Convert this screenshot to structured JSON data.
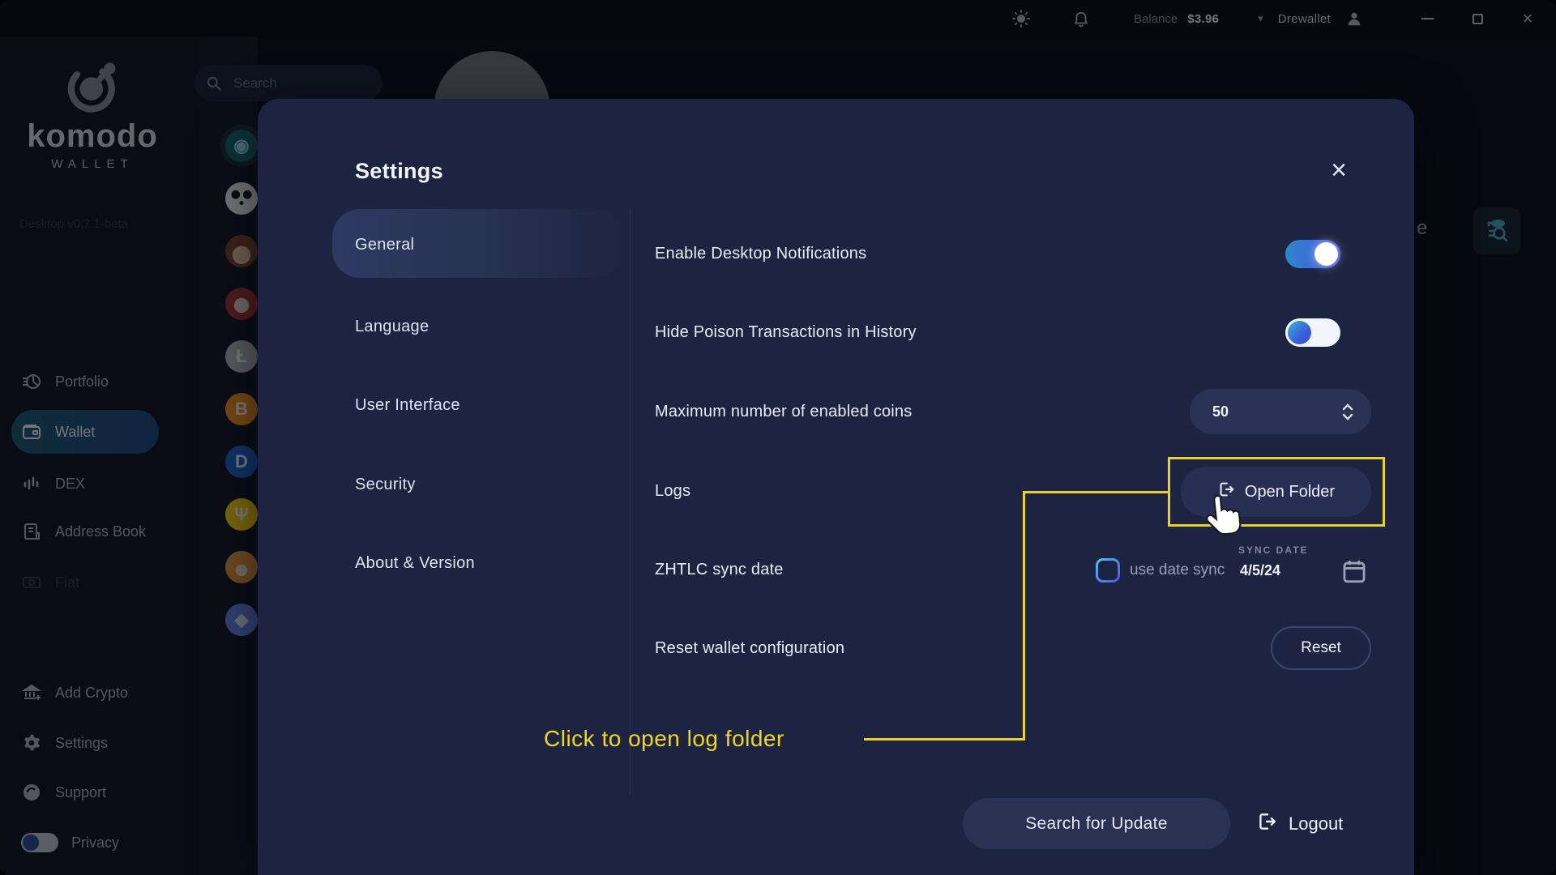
{
  "topbar": {
    "balance_label": "Balance",
    "balance_value": "$3.96",
    "account_name": "Drewallet"
  },
  "search": {
    "placeholder": "Search"
  },
  "sidebar": {
    "logo_title": "komodo",
    "logo_subtitle": "WALLET",
    "version": "Desktop v0.7.1-beta",
    "nav": [
      {
        "label": "Portfolio"
      },
      {
        "label": "Wallet"
      },
      {
        "label": "DEX"
      },
      {
        "label": "Address Book"
      },
      {
        "label": "Fiat"
      }
    ],
    "bottom_nav": [
      {
        "label": "Add Crypto"
      },
      {
        "label": "Settings"
      },
      {
        "label": "Support"
      }
    ],
    "privacy_label": "Privacy"
  },
  "coins": [
    {
      "icon": "komodo-coin-icon",
      "bg": "#156570",
      "letter": "◉",
      "fg": "#9fe0e6"
    },
    {
      "icon": "panda-coin-icon",
      "bg": "radial-gradient(circle at 32% 38%, #15161a 14%, rgba(0,0,0,0) 15%), radial-gradient(circle at 68% 38%, #15161a 14%, rgba(0,0,0,0) 15%), radial-gradient(circle at 50% 64%, #15161a 7%, rgba(0,0,0,0) 8%), #eef0f2",
      "letter": "",
      "fg": ""
    },
    {
      "icon": "anime-girl-coin-icon",
      "bg": "radial-gradient(circle at 50% 62%, #e8c49a 34%, #7a4630 36%)",
      "letter": "",
      "fg": ""
    },
    {
      "icon": "grandma-coin-icon",
      "bg": "radial-gradient(circle at 50% 55%, #e9d9cf 30%, #a43636 32%)",
      "letter": "",
      "fg": ""
    },
    {
      "icon": "litecoin-icon",
      "bg": "#b8babd",
      "letter": "Ł",
      "fg": "#ffffff"
    },
    {
      "icon": "bitcoin-icon",
      "bg": "#f7931a",
      "letter": "B",
      "fg": "#ffffff"
    },
    {
      "icon": "digibyte-icon",
      "bg": "#1f67d2",
      "letter": "D",
      "fg": "#ffffff"
    },
    {
      "icon": "primecoin-icon",
      "bg": "#ffd60a",
      "letter": "Ψ",
      "fg": "#ffffff"
    },
    {
      "icon": "shiba-coin-icon",
      "bg": "radial-gradient(circle at 50% 60%, #f4e6c8 22%, #e8973a 24%)",
      "letter": "",
      "fg": ""
    },
    {
      "icon": "ethereum-icon",
      "bg": "#6b86e8",
      "letter": "◆",
      "fg": "#dfe6ff"
    }
  ],
  "background": {
    "partial_text": "e"
  },
  "modal": {
    "title": "Settings",
    "tabs": [
      {
        "label": "General",
        "active": true
      },
      {
        "label": "Language",
        "active": false
      },
      {
        "label": "User Interface",
        "active": false
      },
      {
        "label": "Security",
        "active": false
      },
      {
        "label": "About & Version",
        "active": false
      }
    ],
    "rows": {
      "notifications": {
        "label": "Enable Desktop Notifications",
        "state": "on"
      },
      "hide_poison": {
        "label": "Hide Poison Transactions in History",
        "state": "on"
      },
      "max_coins": {
        "label": "Maximum number of enabled coins",
        "value": "50"
      },
      "logs": {
        "label": "Logs",
        "button_label": "Open Folder"
      },
      "zhtlc": {
        "label": "ZHTLC sync date",
        "checkbox_label": "use date sync",
        "checkbox_checked": false,
        "sync_date_label": "SYNC DATE",
        "sync_date_value": "4/5/24"
      },
      "reset": {
        "label": "Reset wallet configuration",
        "button_label": "Reset"
      }
    },
    "footer": {
      "update_label": "Search for Update",
      "logout_label": "Logout"
    }
  },
  "annotation": {
    "text": "Click to open log folder",
    "color": "#f2d622"
  },
  "colors": {
    "accent_yellow": "#e9d32b",
    "toggle_on_start": "#2f86c8",
    "toggle_on_end": "#4753e8",
    "modal_bg": "#1d2442",
    "checkbox_border": "#4f83f0",
    "active_nav_start": "#2a8fae",
    "active_nav_end": "#2c6fc4"
  }
}
